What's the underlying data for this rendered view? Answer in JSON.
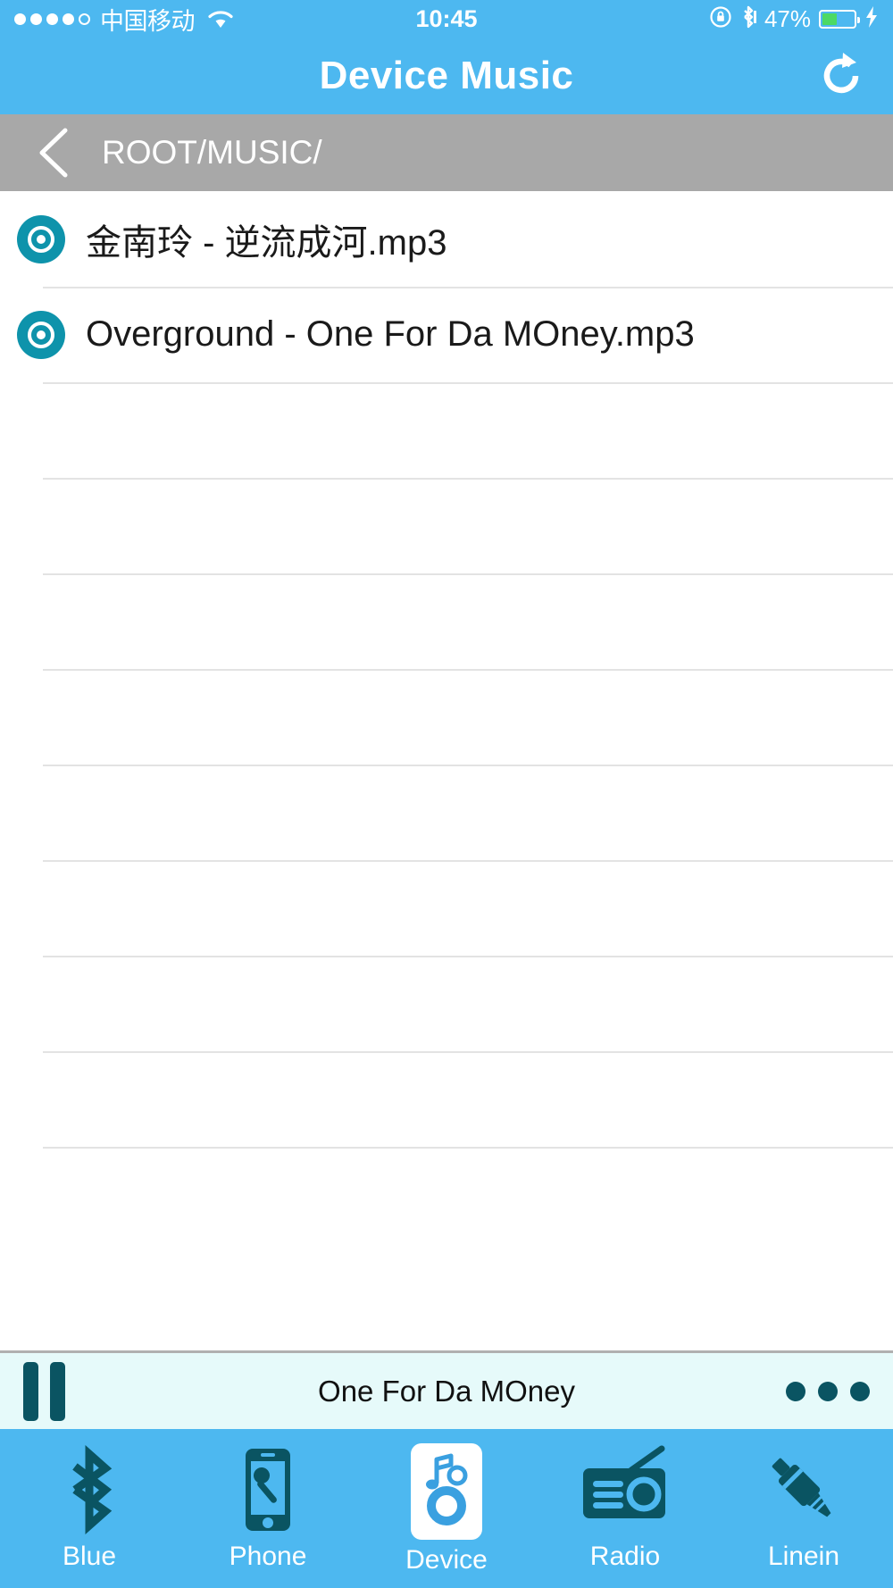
{
  "status_bar": {
    "carrier": "中国移动",
    "signal_dots_filled": 4,
    "signal_dots_total": 5,
    "wifi_icon": "wifi-icon",
    "time": "10:45",
    "rotation_lock_icon": "rotation-lock-icon",
    "bluetooth_icon": "bluetooth-status-icon",
    "battery_percent": "47%",
    "battery_level": 47,
    "battery_color": "#4cd964",
    "charging_icon": "lightning-bolt-icon"
  },
  "header": {
    "title": "Device Music",
    "refresh_icon": "refresh-icon",
    "background_color": "#4db8f0"
  },
  "breadcrumb": {
    "back_icon": "back-chevron-icon",
    "path": "ROOT/MUSIC/",
    "background_color": "#a8a8a8"
  },
  "file_list": {
    "item_icon": "disc-icon",
    "icon_color": "#0e93ab",
    "items": [
      {
        "name": "金南玲 - 逆流成河.mp3"
      },
      {
        "name": "Overground - One For Da MOney.mp3"
      }
    ],
    "empty_row_count": 9
  },
  "player": {
    "play_state_icon": "pause-icon",
    "now_playing": "One For Da MOney",
    "more_icon": "more-dots-icon",
    "background_color": "#e6fafa",
    "accent_color": "#0a5462"
  },
  "tabbar": {
    "background_color": "#4db8f0",
    "active_index": 2,
    "tabs": [
      {
        "label": "Blue",
        "icon": "bluetooth-icon"
      },
      {
        "label": "Phone",
        "icon": "phone-microphone-icon"
      },
      {
        "label": "Device",
        "icon": "device-music-icon"
      },
      {
        "label": "Radio",
        "icon": "radio-icon"
      },
      {
        "label": "Linein",
        "icon": "audio-jack-icon"
      }
    ]
  }
}
